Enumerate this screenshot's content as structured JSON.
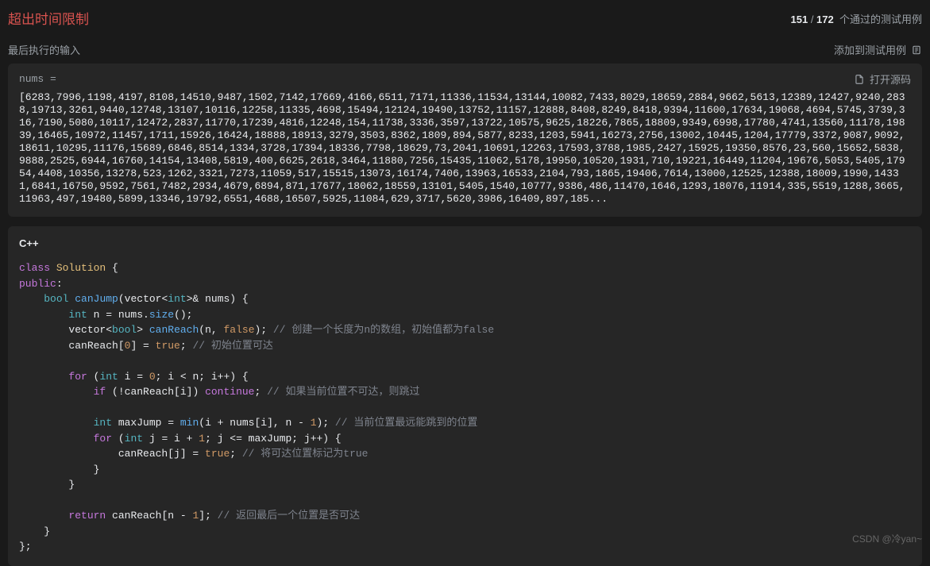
{
  "header": {
    "status_title": "超出时间限制",
    "passed": "151",
    "total": "172",
    "stats_suffix": "个通过的测试用例"
  },
  "subheader": {
    "last_input_label": "最后执行的输入",
    "add_testcase_label": "添加到测试用例"
  },
  "input_panel": {
    "var_label": "nums =",
    "open_source_label": "打开源码",
    "value": "[6283,7996,1198,4197,8108,14510,9487,1502,7142,17669,4166,6511,7171,11336,11534,13144,10082,7433,8029,18659,2884,9662,5613,12389,12427,9240,2838,19713,3261,9440,12748,13107,10116,12258,11335,4698,15494,12124,19490,13752,11157,12888,8408,8249,8418,9394,11600,17634,19068,4694,5745,3739,316,7190,5080,10117,12472,2837,11770,17239,4816,12248,154,11738,3336,3597,13722,10575,9625,18226,7865,18809,9349,6998,17780,4741,13560,11178,19839,16465,10972,11457,1711,15926,16424,18888,18913,3279,3503,8362,1809,894,5877,8233,1203,5941,16273,2756,13002,10445,1204,17779,3372,9087,9092,18611,10295,11176,15689,6846,8514,1334,3728,17394,18336,7798,18629,73,2041,10691,12263,17593,3788,1985,2427,15925,19350,8576,23,560,15652,5838,9888,2525,6944,16760,14154,13408,5819,400,6625,2618,3464,11880,7256,15435,11062,5178,19950,10520,1931,710,19221,16449,11204,19676,5053,5405,17954,4408,10356,13278,523,1262,3321,7273,11059,517,15515,13073,16174,7406,13963,16533,2104,793,1865,19406,7614,13000,12525,12388,18009,1990,14331,6841,16750,9592,7561,7482,2934,4679,6894,871,17677,18062,18559,13101,5405,1540,10777,9386,486,11470,1646,1293,18076,11914,335,5519,1288,3665,11963,497,19480,5899,13346,19792,6551,4688,16507,5925,11084,629,3717,5620,3986,16409,897,185..."
  },
  "code": {
    "language": "C++",
    "comments": {
      "c1": "// 创建一个长度为n的数组，初始值都为false",
      "c2": "// 初始位置可达",
      "c3": "// 如果当前位置不可达，则跳过",
      "c4": "// 当前位置最远能跳到的位置",
      "c5": "// 将可达位置标记为true",
      "c6": "// 返回最后一个位置是否可达"
    }
  },
  "watermark": "CSDN @冷yan~"
}
